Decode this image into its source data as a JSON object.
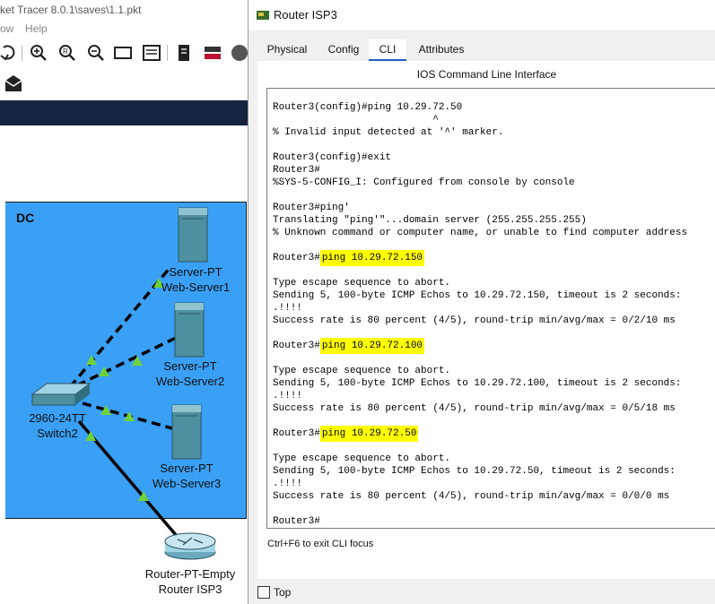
{
  "bg_window": {
    "title": "ket Tracer 8.0.1\\saves\\1.1.pkt",
    "menu": [
      "ow",
      "Help"
    ]
  },
  "workspace": {
    "area_label": "DC",
    "devices": [
      {
        "type": "Server-PT",
        "name": "Web-Server1"
      },
      {
        "type": "Server-PT",
        "name": "Web-Server2"
      },
      {
        "type": "Server-PT",
        "name": "Web-Server3"
      },
      {
        "type": "2960-24TT",
        "name": "Switch2"
      },
      {
        "type": "Router-PT-Empty",
        "name": "Router ISP3"
      }
    ]
  },
  "dialog": {
    "title": "Router ISP3",
    "tabs": [
      {
        "label": "Physical",
        "active": false
      },
      {
        "label": "Config",
        "active": false
      },
      {
        "label": "CLI",
        "active": true
      },
      {
        "label": "Attributes",
        "active": false
      }
    ],
    "cli_heading": "IOS Command Line Interface",
    "cli_lines": [
      {
        "prefix": "Router3(config)#ping 10.29.72.50",
        "hl": ""
      },
      {
        "prefix": "                           ^",
        "hl": ""
      },
      {
        "prefix": "% Invalid input detected at '^' marker.",
        "hl": ""
      },
      {
        "prefix": "",
        "hl": ""
      },
      {
        "prefix": "Router3(config)#exit",
        "hl": ""
      },
      {
        "prefix": "Router3#",
        "hl": ""
      },
      {
        "prefix": "%SYS-5-CONFIG_I: Configured from console by console",
        "hl": ""
      },
      {
        "prefix": "",
        "hl": ""
      },
      {
        "prefix": "Router3#ping'",
        "hl": ""
      },
      {
        "prefix": "Translating \"ping'\"...domain server (255.255.255.255)",
        "hl": ""
      },
      {
        "prefix": "% Unknown command or computer name, or unable to find computer address",
        "hl": ""
      },
      {
        "prefix": "",
        "hl": ""
      },
      {
        "prefix": "Router3#",
        "hl": "ping 10.29.72.150"
      },
      {
        "prefix": "",
        "hl": ""
      },
      {
        "prefix": "Type escape sequence to abort.",
        "hl": ""
      },
      {
        "prefix": "Sending 5, 100-byte ICMP Echos to 10.29.72.150, timeout is 2 seconds:",
        "hl": ""
      },
      {
        "prefix": ".!!!!",
        "hl": ""
      },
      {
        "prefix": "Success rate is 80 percent (4/5), round-trip min/avg/max = 0/2/10 ms",
        "hl": ""
      },
      {
        "prefix": "",
        "hl": ""
      },
      {
        "prefix": "Router3#",
        "hl": "ping 10.29.72.100"
      },
      {
        "prefix": "",
        "hl": ""
      },
      {
        "prefix": "Type escape sequence to abort.",
        "hl": ""
      },
      {
        "prefix": "Sending 5, 100-byte ICMP Echos to 10.29.72.100, timeout is 2 seconds:",
        "hl": ""
      },
      {
        "prefix": ".!!!!",
        "hl": ""
      },
      {
        "prefix": "Success rate is 80 percent (4/5), round-trip min/avg/max = 0/5/18 ms",
        "hl": ""
      },
      {
        "prefix": "",
        "hl": ""
      },
      {
        "prefix": "Router3#",
        "hl": "ping 10.29.72.50"
      },
      {
        "prefix": "",
        "hl": ""
      },
      {
        "prefix": "Type escape sequence to abort.",
        "hl": ""
      },
      {
        "prefix": "Sending 5, 100-byte ICMP Echos to 10.29.72.50, timeout is 2 seconds:",
        "hl": ""
      },
      {
        "prefix": ".!!!!",
        "hl": ""
      },
      {
        "prefix": "Success rate is 80 percent (4/5), round-trip min/avg/max = 0/0/0 ms",
        "hl": ""
      },
      {
        "prefix": "",
        "hl": ""
      },
      {
        "prefix": "Router3#",
        "hl": ""
      }
    ],
    "hint": "Ctrl+F6 to exit CLI focus",
    "top_checkbox": {
      "label": "Top",
      "checked": false
    }
  },
  "colors": {
    "dc_area": "#3aa0f5",
    "highlight": "#ffff00",
    "nav_bar": "#14233f",
    "active_tab_underline": "#1f5fbf",
    "link_indicator": "#6fd23a"
  }
}
